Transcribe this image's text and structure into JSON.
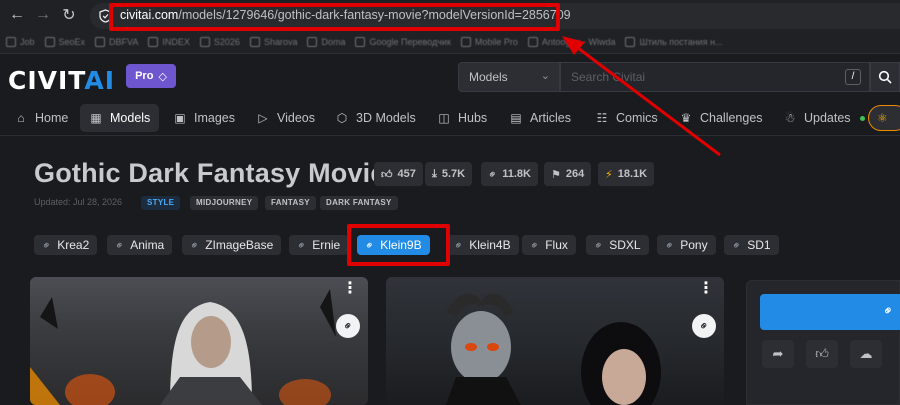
{
  "browser": {
    "url_host": "civitai.com",
    "url_path": "/models/1279646/gothic-dark-fantasy-movie?modelVersionId=2856709",
    "bookmarks": [
      "Job",
      "SeoEx",
      "DBFVA",
      "INDEX",
      "S2026",
      "Sharova",
      "Doma",
      "Google Переводчик",
      "Mobile Pro",
      "Antoogon - Wiwda",
      "Штиль постания н..."
    ]
  },
  "header": {
    "logo_main": "CIVIT",
    "logo_accent": "AI",
    "pro_label": "Pro",
    "search_scope": "Models",
    "search_placeholder": "Search Civitai",
    "search_hotkey": "/"
  },
  "nav": {
    "items": [
      {
        "label": "Home",
        "icon": "home-icon"
      },
      {
        "label": "Models",
        "icon": "grid-icon"
      },
      {
        "label": "Images",
        "icon": "image-icon"
      },
      {
        "label": "Videos",
        "icon": "video-icon"
      },
      {
        "label": "3D Models",
        "icon": "cube-icon"
      },
      {
        "label": "Hubs",
        "icon": "hub-icon"
      },
      {
        "label": "Articles",
        "icon": "article-icon"
      },
      {
        "label": "Comics",
        "icon": "book-icon"
      },
      {
        "label": "Challenges",
        "icon": "trophy-icon"
      },
      {
        "label": "Updates",
        "icon": "bell-icon"
      }
    ]
  },
  "model": {
    "title": "Gothic Dark Fantasy Movie",
    "stats": {
      "likes": "457",
      "downloads": "5.7K",
      "generations": "11.8K",
      "bookmarks": "264",
      "buzz": "18.1K"
    },
    "updated": "Updated: Jul 28, 2026",
    "tags": [
      "STYLE",
      "MIDJOURNEY",
      "FANTASY",
      "DARK FANTASY"
    ],
    "versions": [
      "Krea2",
      "Anima",
      "ZImageBase",
      "Ernie",
      "Klein9B",
      "Klein4B",
      "Flux",
      "SDXL",
      "Pony",
      "SD1"
    ],
    "active_version": "Klein9B"
  },
  "colors": {
    "accent": "#228be6",
    "annotation": "#e00000",
    "pro": "#6e56cf"
  }
}
